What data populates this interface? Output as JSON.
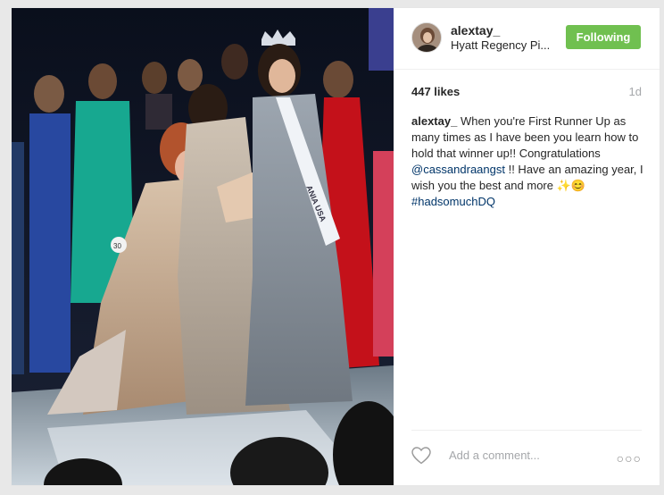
{
  "post": {
    "username": "alextay_",
    "location": "Hyatt Regency Pi...",
    "follow_button": "Following",
    "likes": "447 likes",
    "age": "1d",
    "caption": {
      "user": "alextay_",
      "text_1": " When you're First Runner Up as many times as I have been you learn how to hold that winner up!! Congratulations ",
      "mention": "@cassandraangst",
      "text_2": " !! Have an amazing year, I wish you the best and more ",
      "emoji": "✨😊",
      "hashtag": "#hadsomuchDQ"
    },
    "comment_placeholder": "Add a comment...",
    "more_label": "○○○",
    "photo": {
      "sash_text": "ANIA USA",
      "contestant_number": "30"
    }
  },
  "colors": {
    "follow_green": "#70c050",
    "link_blue": "#003569",
    "muted_gray": "#a5a7aa"
  },
  "icons": [
    "heart-icon",
    "more-options-icon",
    "crown-icon"
  ]
}
